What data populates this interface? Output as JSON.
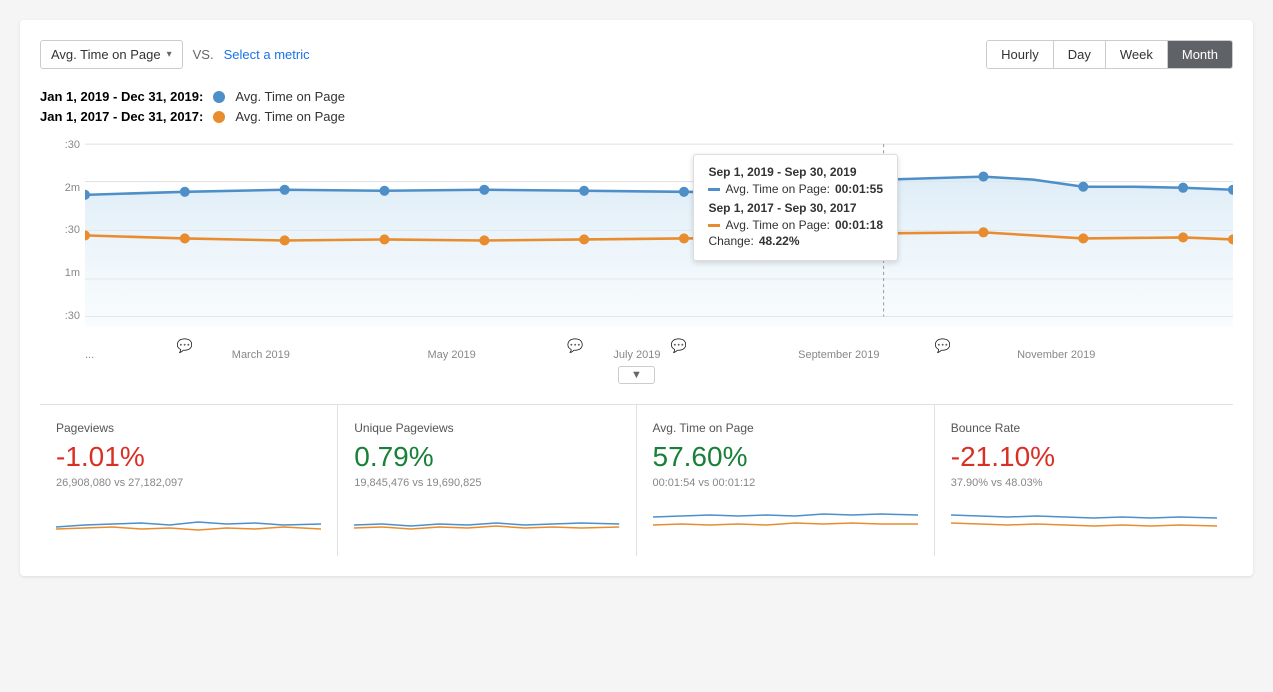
{
  "toolbar": {
    "metric_label": "Avg. Time on Page",
    "vs_label": "VS.",
    "select_metric_label": "Select a metric"
  },
  "time_buttons": [
    {
      "label": "Hourly",
      "active": false
    },
    {
      "label": "Day",
      "active": false
    },
    {
      "label": "Week",
      "active": false
    },
    {
      "label": "Month",
      "active": true
    }
  ],
  "legend": [
    {
      "date_range": "Jan 1, 2019 - Dec 31, 2019:",
      "metric": "Avg. Time on Page",
      "color": "#4e8fc8"
    },
    {
      "date_range": "Jan 1, 2017 - Dec 31, 2017:",
      "metric": "Avg. Time on Page",
      "color": "#e88c2e"
    }
  ],
  "y_axis": [
    ":30",
    "2m",
    ":30",
    "1m",
    ":30"
  ],
  "x_axis": [
    "...",
    "March 2019",
    "May 2019",
    "July 2019",
    "September 2019",
    "November 2019",
    ""
  ],
  "tooltip": {
    "title1": "Sep 1, 2019 - Sep 30, 2019",
    "row1_label": "Avg. Time on Page:",
    "row1_value": "00:01:55",
    "title2": "Sep 1, 2017 - Sep 30, 2017",
    "row2_label": "Avg. Time on Page:",
    "row2_value": "00:01:18",
    "change_label": "Change:",
    "change_value": "48.22%",
    "color1": "#4e8fc8",
    "color2": "#e88c2e"
  },
  "stats": [
    {
      "title": "Pageviews",
      "pct": "-1.01%",
      "pct_type": "negative",
      "comparison": "26,908,080 vs 27,182,097"
    },
    {
      "title": "Unique Pageviews",
      "pct": "0.79%",
      "pct_type": "positive",
      "comparison": "19,845,476 vs 19,690,825"
    },
    {
      "title": "Avg. Time on Page",
      "pct": "57.60%",
      "pct_type": "positive",
      "comparison": "00:01:54 vs 00:01:12"
    },
    {
      "title": "Bounce Rate",
      "pct": "-21.10%",
      "pct_type": "negative",
      "comparison": "37.90% vs 48.03%"
    }
  ],
  "icons": {
    "chevron_down": "▾",
    "annotation": "💬",
    "dropdown_arrow": "▼"
  }
}
